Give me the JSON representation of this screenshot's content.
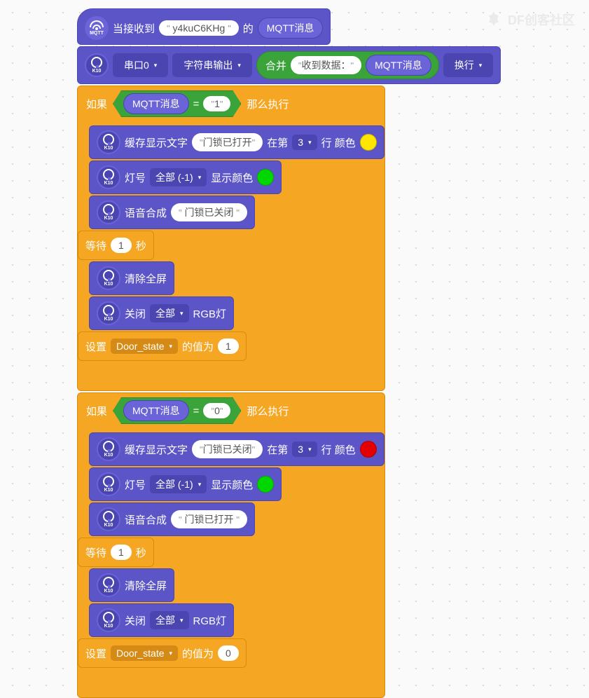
{
  "watermark": "DF创客社区",
  "icon_labels": {
    "mqtt": "MQTT",
    "k10": "K10"
  },
  "hat": {
    "prefix": "当接收到",
    "topic": "y4kuC6KHg",
    "mid": "的",
    "msg_label": "MQTT消息"
  },
  "serial": {
    "port": "串口0",
    "mode": "字符串输出",
    "concat": "合并",
    "prefix_text": "收到数据：",
    "msg_label": "MQTT消息",
    "newline": "换行"
  },
  "if1": {
    "if_label": "如果",
    "msg_label": "MQTT消息",
    "eq": "=",
    "val": "1",
    "then": "那么执行",
    "cache_text": {
      "label": "缓存显示文字",
      "text": "门锁已打开",
      "at": "在第",
      "line": "3",
      "line_suffix": "行 颜色"
    },
    "led": {
      "label": "灯号",
      "target": "全部 (-1)",
      "color_label": "显示颜色"
    },
    "tts": {
      "label": "语音合成",
      "text": "门锁已关闭"
    },
    "wait": {
      "label1": "等待",
      "val": "1",
      "label2": "秒"
    },
    "clear": "清除全屏",
    "rgb_off": {
      "label1": "关闭",
      "target": "全部",
      "label2": "RGB灯"
    },
    "set_var": {
      "label1": "设置",
      "var": "Door_state",
      "label2": "的值为",
      "val": "1"
    }
  },
  "if2": {
    "if_label": "如果",
    "msg_label": "MQTT消息",
    "eq": "=",
    "val": "0",
    "then": "那么执行",
    "cache_text": {
      "label": "缓存显示文字",
      "text": "门锁已关闭",
      "at": "在第",
      "line": "3",
      "line_suffix": "行 颜色"
    },
    "led": {
      "label": "灯号",
      "target": "全部 (-1)",
      "color_label": "显示颜色"
    },
    "tts": {
      "label": "语音合成",
      "text": "门锁已打开"
    },
    "wait": {
      "label1": "等待",
      "val": "1",
      "label2": "秒"
    },
    "clear": "清除全屏",
    "rgb_off": {
      "label1": "关闭",
      "target": "全部",
      "label2": "RGB灯"
    },
    "set_var": {
      "label1": "设置",
      "var": "Door_state",
      "label2": "的值为",
      "val": "0"
    }
  }
}
